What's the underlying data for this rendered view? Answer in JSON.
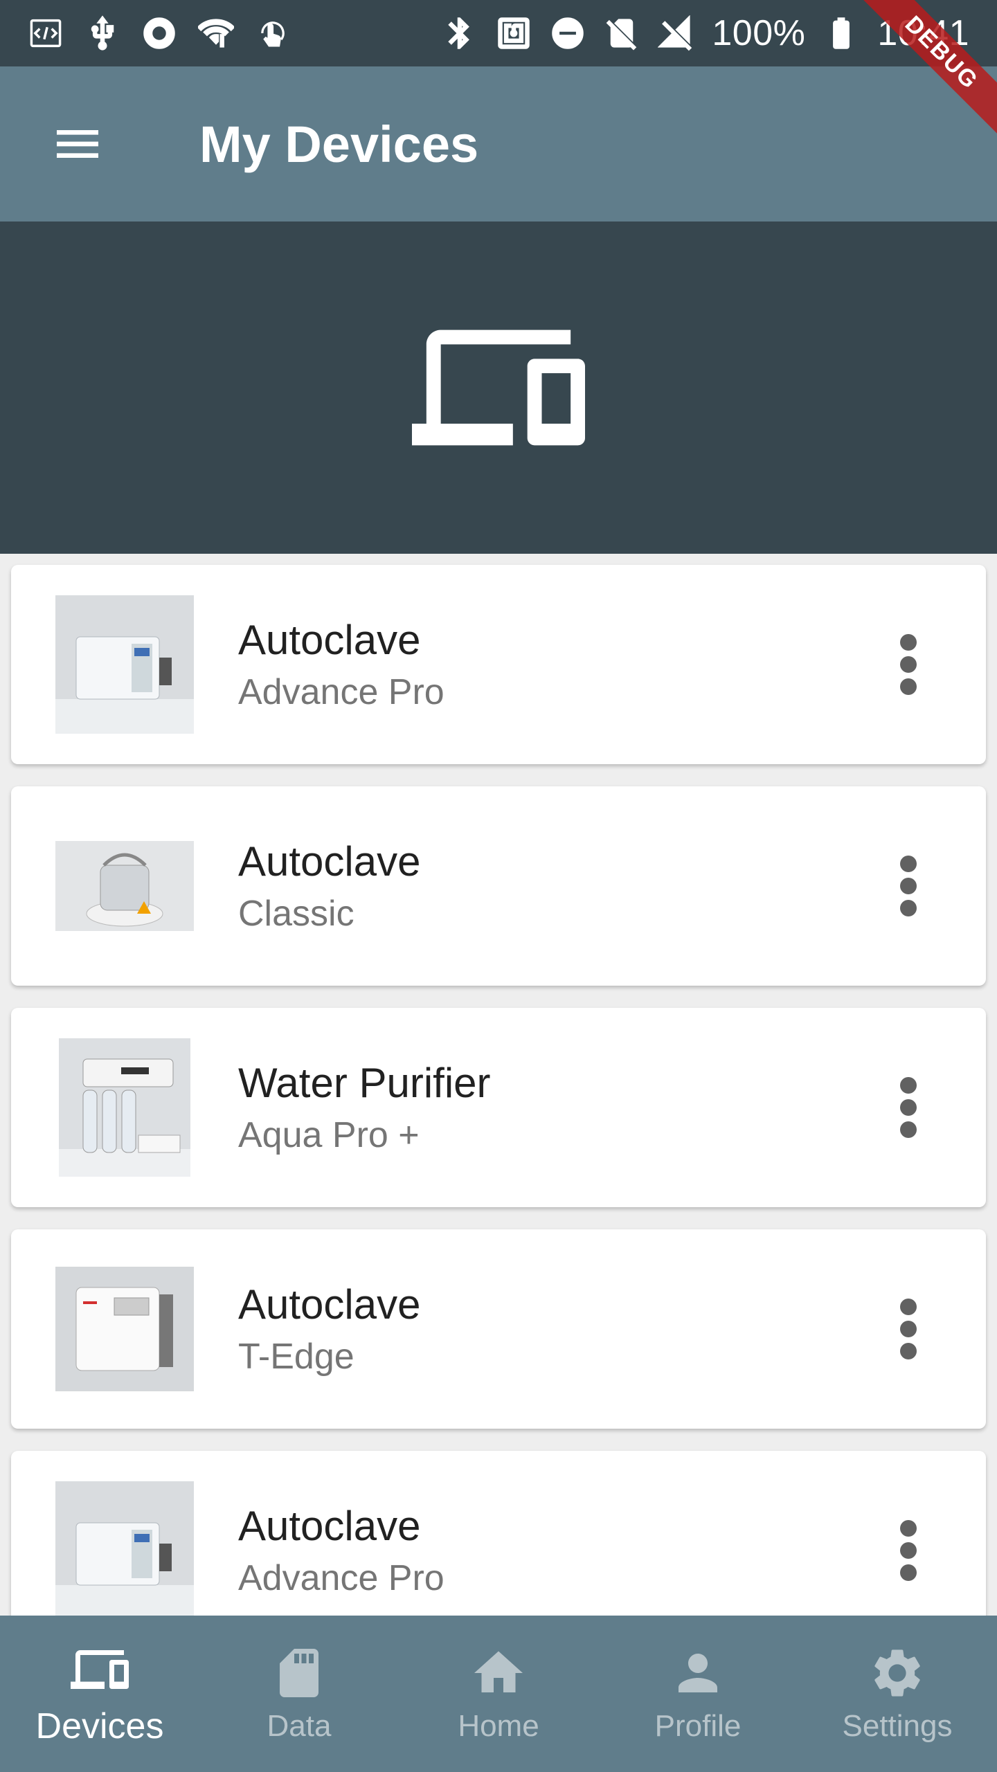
{
  "status_bar": {
    "battery_percent": "100%",
    "time": "10:41",
    "left_icons": [
      "code-icon",
      "usb-icon",
      "record-icon",
      "wifi-alert-icon",
      "touch-icon"
    ],
    "right_icons": [
      "bluetooth-icon",
      "nfc-icon",
      "do-not-disturb-icon",
      "no-sim-icon",
      "signal-off-icon",
      "battery-icon"
    ]
  },
  "debug_banner": "DEBUG",
  "app_bar": {
    "title": "My Devices",
    "menu_icon": "menu-icon"
  },
  "header": {
    "icon": "devices-icon"
  },
  "devices": [
    {
      "name": "Autoclave",
      "model": "Advance Pro",
      "thumb": "autoclave-advance-pro"
    },
    {
      "name": "Autoclave",
      "model": "Classic",
      "thumb": "autoclave-classic"
    },
    {
      "name": "Water Purifier",
      "model": "Aqua Pro +",
      "thumb": "water-purifier"
    },
    {
      "name": "Autoclave",
      "model": "T-Edge",
      "thumb": "autoclave-t-edge"
    },
    {
      "name": "Autoclave",
      "model": "Advance Pro",
      "thumb": "autoclave-advance-pro"
    }
  ],
  "bottom_nav": {
    "items": [
      {
        "label": "Devices",
        "icon": "devices-icon",
        "active": true
      },
      {
        "label": "Data",
        "icon": "sd-card-icon",
        "active": false
      },
      {
        "label": "Home",
        "icon": "home-icon",
        "active": false
      },
      {
        "label": "Profile",
        "icon": "person-icon",
        "active": false
      },
      {
        "label": "Settings",
        "icon": "gear-icon",
        "active": false
      }
    ]
  },
  "colors": {
    "app_bar": "#607D8B",
    "header": "#37474F",
    "background": "#EEEEEE",
    "card": "#FFFFFF",
    "debug": "#B71C1C"
  }
}
